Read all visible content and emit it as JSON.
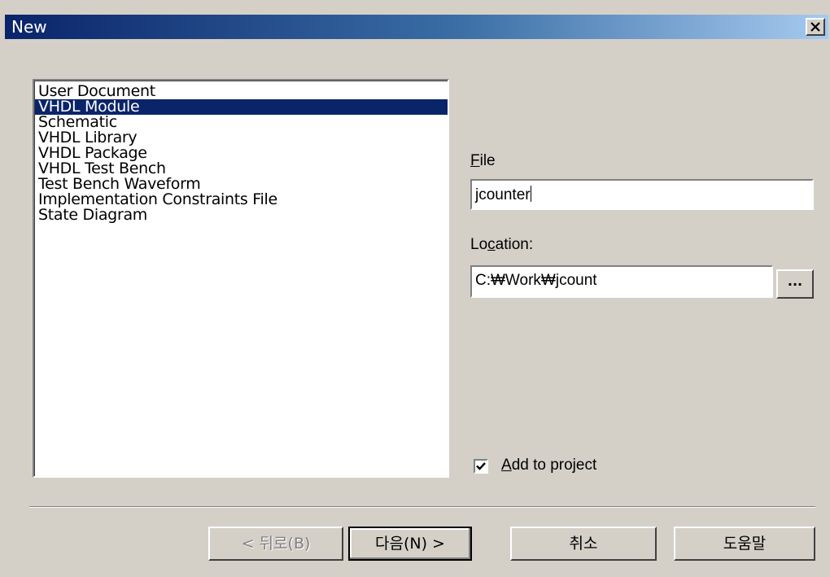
{
  "window": {
    "title": "New",
    "close_label": "✕"
  },
  "source_list": {
    "items": [
      "User Document",
      "VHDL Module",
      "Schematic",
      "VHDL Library",
      "VHDL Package",
      "VHDL Test Bench",
      "Test Bench Waveform",
      "Implementation Constraints File",
      "State Diagram"
    ],
    "selected_index": 1
  },
  "file": {
    "label_mnemonic": "F",
    "label_rest": "ile",
    "value": "jcounter"
  },
  "location": {
    "label_pre": "Lo",
    "label_mnemonic": "c",
    "label_rest": "ation:",
    "value": "C:\\Work\\jcount",
    "value_display": "C:₩Work₩jcount",
    "browse_label": "..."
  },
  "add_to_project": {
    "checked": true,
    "label_mnemonic": "A",
    "label_rest": "dd to project"
  },
  "buttons": {
    "back_label": "< 뒤로(B)",
    "back_enabled": false,
    "next_label": "다음(N) >",
    "cancel_label": "취소",
    "help_label": "도움말"
  }
}
